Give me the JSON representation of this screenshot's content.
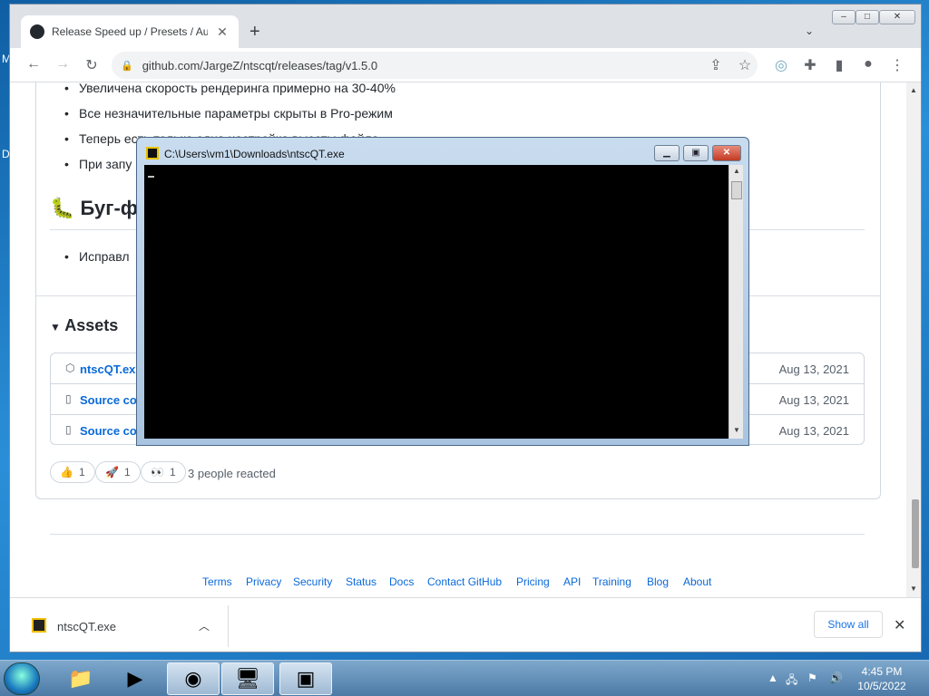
{
  "browser": {
    "tab_title": "Release Speed up / Presets / Auc",
    "url": "github.com/JargeZ/ntscqt/releases/tag/v1.5.0",
    "window_controls": [
      "–",
      "□",
      "✕"
    ]
  },
  "page": {
    "bullets_top": [
      "Увеличена скорость рендеринга примерно на 30-40%",
      "Все незначительные параметры скрыты в Pro-режим",
      "Теперь есть только одна настройка высоты файла",
      "При запу"
    ],
    "bug_heading": "Буг-ф",
    "bug_bullet": "Исправл",
    "assets_heading": "Assets",
    "assets": [
      {
        "name": "ntscQT.exe",
        "date": "Aug 13, 2021"
      },
      {
        "name": "Source co",
        "date": "Aug 13, 2021"
      },
      {
        "name": "Source co",
        "date": "Aug 13, 2021"
      }
    ],
    "reactions": [
      {
        "emoji": "👍",
        "count": "1"
      },
      {
        "emoji": "🚀",
        "count": "1"
      },
      {
        "emoji": "👀",
        "count": "1"
      }
    ],
    "reactions_text": "3 people reacted",
    "footer_links": [
      "Terms",
      "Privacy",
      "Security",
      "Status",
      "Docs",
      "Contact GitHub",
      "Pricing",
      "API",
      "Training",
      "Blog",
      "About"
    ]
  },
  "downloads": {
    "file": "ntscQT.exe",
    "show_all": "Show all"
  },
  "console": {
    "title": "C:\\Users\\vm1\\Downloads\\ntscQT.exe"
  },
  "taskbar": {
    "time": "4:45 PM",
    "date": "10/5/2022"
  },
  "desktop": {
    "edge_letters": [
      "M",
      "D"
    ]
  }
}
